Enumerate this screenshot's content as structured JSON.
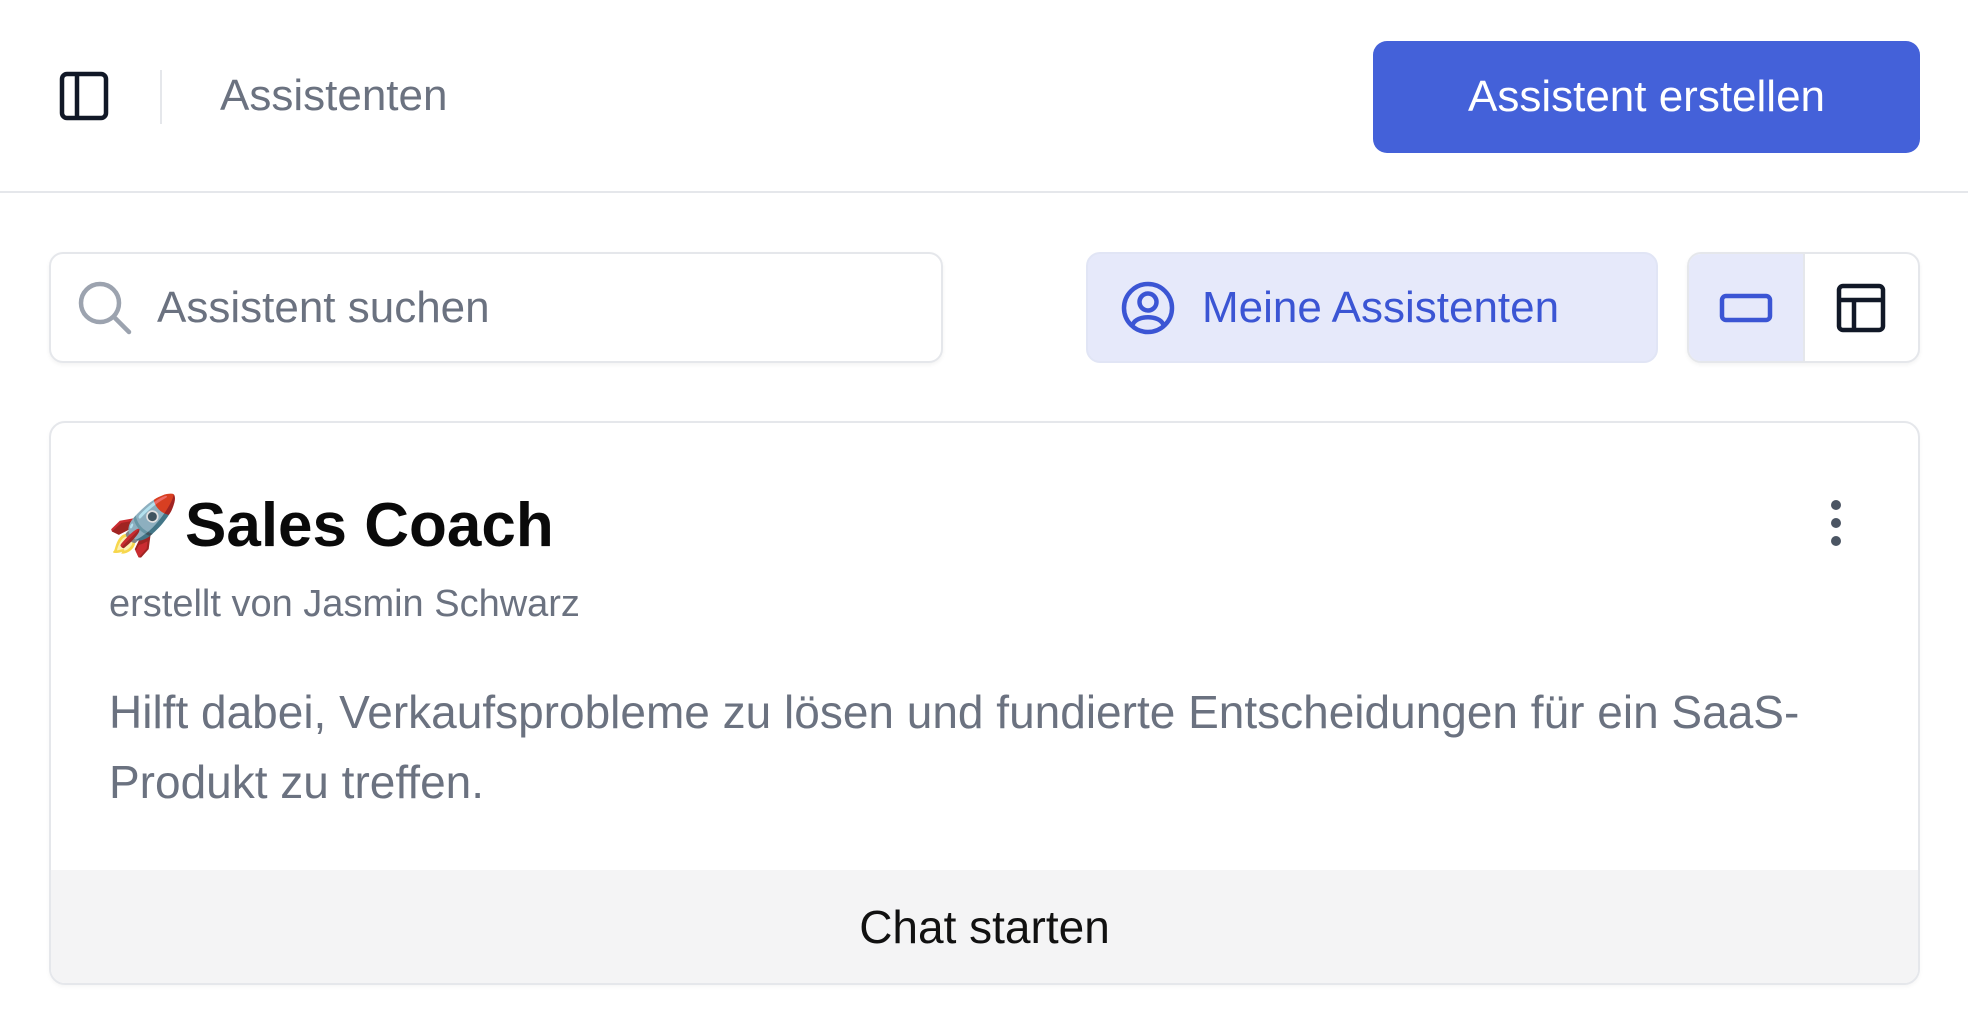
{
  "header": {
    "title": "Assistenten",
    "create_button": "Assistent erstellen",
    "sidebar_toggle_icon": "sidebar-toggle-icon"
  },
  "toolbar": {
    "search_placeholder": "Assistent suchen",
    "search_value": "",
    "filter_label": "Meine Assistenten",
    "filter_icon": "user-circle-icon",
    "view_modes": [
      "card-view",
      "table-view"
    ],
    "active_view": "card-view"
  },
  "assistants": [
    {
      "emoji": "🚀",
      "name": "Sales Coach",
      "author": "erstellt von Jasmin Schwarz",
      "description": "Hilft dabei, Verkaufsprobleme zu lösen und fundierte Entscheidungen für ein SaaS-Produkt zu treffen.",
      "action_label": "Chat starten"
    }
  ],
  "colors": {
    "accent": "#4461d9",
    "accent_soft": "#e6e9fa",
    "muted_text": "#6b7280",
    "border": "#e5e7eb"
  }
}
